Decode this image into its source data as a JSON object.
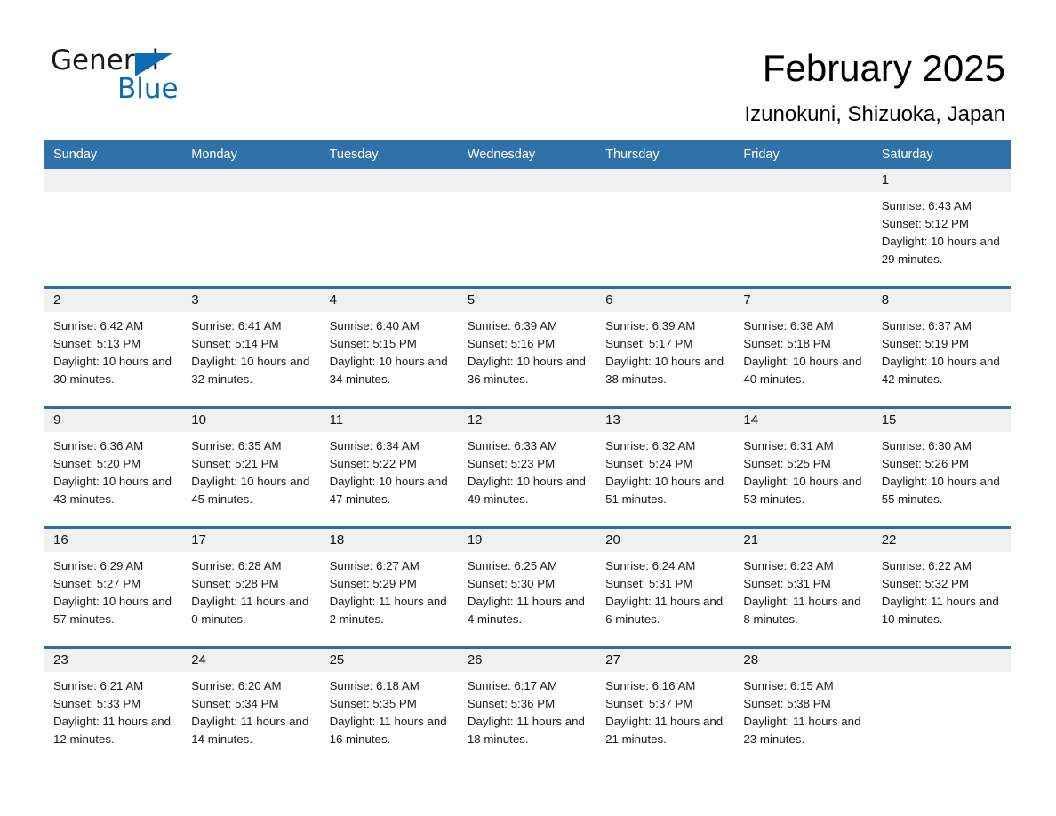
{
  "brand": {
    "name_top": "General",
    "name_bottom": "Blue",
    "triangle_icon": "blue-triangle-icon",
    "accent_color": "#0a6cb4"
  },
  "header": {
    "title": "February 2025",
    "subtitle": "Izunokuni, Shizuoka, Japan"
  },
  "theme": {
    "header_blue": "#3071a9",
    "row_border_blue": "#2e6da4",
    "daynum_strip": "#f0f0f0"
  },
  "calendar": {
    "weekday_headers": [
      "Sunday",
      "Monday",
      "Tuesday",
      "Wednesday",
      "Thursday",
      "Friday",
      "Saturday"
    ],
    "weeks": [
      [
        {
          "day": "",
          "sunrise": "",
          "sunset": "",
          "daylight": ""
        },
        {
          "day": "",
          "sunrise": "",
          "sunset": "",
          "daylight": ""
        },
        {
          "day": "",
          "sunrise": "",
          "sunset": "",
          "daylight": ""
        },
        {
          "day": "",
          "sunrise": "",
          "sunset": "",
          "daylight": ""
        },
        {
          "day": "",
          "sunrise": "",
          "sunset": "",
          "daylight": ""
        },
        {
          "day": "",
          "sunrise": "",
          "sunset": "",
          "daylight": ""
        },
        {
          "day": "1",
          "sunrise": "Sunrise: 6:43 AM",
          "sunset": "Sunset: 5:12 PM",
          "daylight": "Daylight: 10 hours and 29 minutes."
        }
      ],
      [
        {
          "day": "2",
          "sunrise": "Sunrise: 6:42 AM",
          "sunset": "Sunset: 5:13 PM",
          "daylight": "Daylight: 10 hours and 30 minutes."
        },
        {
          "day": "3",
          "sunrise": "Sunrise: 6:41 AM",
          "sunset": "Sunset: 5:14 PM",
          "daylight": "Daylight: 10 hours and 32 minutes."
        },
        {
          "day": "4",
          "sunrise": "Sunrise: 6:40 AM",
          "sunset": "Sunset: 5:15 PM",
          "daylight": "Daylight: 10 hours and 34 minutes."
        },
        {
          "day": "5",
          "sunrise": "Sunrise: 6:39 AM",
          "sunset": "Sunset: 5:16 PM",
          "daylight": "Daylight: 10 hours and 36 minutes."
        },
        {
          "day": "6",
          "sunrise": "Sunrise: 6:39 AM",
          "sunset": "Sunset: 5:17 PM",
          "daylight": "Daylight: 10 hours and 38 minutes."
        },
        {
          "day": "7",
          "sunrise": "Sunrise: 6:38 AM",
          "sunset": "Sunset: 5:18 PM",
          "daylight": "Daylight: 10 hours and 40 minutes."
        },
        {
          "day": "8",
          "sunrise": "Sunrise: 6:37 AM",
          "sunset": "Sunset: 5:19 PM",
          "daylight": "Daylight: 10 hours and 42 minutes."
        }
      ],
      [
        {
          "day": "9",
          "sunrise": "Sunrise: 6:36 AM",
          "sunset": "Sunset: 5:20 PM",
          "daylight": "Daylight: 10 hours and 43 minutes."
        },
        {
          "day": "10",
          "sunrise": "Sunrise: 6:35 AM",
          "sunset": "Sunset: 5:21 PM",
          "daylight": "Daylight: 10 hours and 45 minutes."
        },
        {
          "day": "11",
          "sunrise": "Sunrise: 6:34 AM",
          "sunset": "Sunset: 5:22 PM",
          "daylight": "Daylight: 10 hours and 47 minutes."
        },
        {
          "day": "12",
          "sunrise": "Sunrise: 6:33 AM",
          "sunset": "Sunset: 5:23 PM",
          "daylight": "Daylight: 10 hours and 49 minutes."
        },
        {
          "day": "13",
          "sunrise": "Sunrise: 6:32 AM",
          "sunset": "Sunset: 5:24 PM",
          "daylight": "Daylight: 10 hours and 51 minutes."
        },
        {
          "day": "14",
          "sunrise": "Sunrise: 6:31 AM",
          "sunset": "Sunset: 5:25 PM",
          "daylight": "Daylight: 10 hours and 53 minutes."
        },
        {
          "day": "15",
          "sunrise": "Sunrise: 6:30 AM",
          "sunset": "Sunset: 5:26 PM",
          "daylight": "Daylight: 10 hours and 55 minutes."
        }
      ],
      [
        {
          "day": "16",
          "sunrise": "Sunrise: 6:29 AM",
          "sunset": "Sunset: 5:27 PM",
          "daylight": "Daylight: 10 hours and 57 minutes."
        },
        {
          "day": "17",
          "sunrise": "Sunrise: 6:28 AM",
          "sunset": "Sunset: 5:28 PM",
          "daylight": "Daylight: 11 hours and 0 minutes."
        },
        {
          "day": "18",
          "sunrise": "Sunrise: 6:27 AM",
          "sunset": "Sunset: 5:29 PM",
          "daylight": "Daylight: 11 hours and 2 minutes."
        },
        {
          "day": "19",
          "sunrise": "Sunrise: 6:25 AM",
          "sunset": "Sunset: 5:30 PM",
          "daylight": "Daylight: 11 hours and 4 minutes."
        },
        {
          "day": "20",
          "sunrise": "Sunrise: 6:24 AM",
          "sunset": "Sunset: 5:31 PM",
          "daylight": "Daylight: 11 hours and 6 minutes."
        },
        {
          "day": "21",
          "sunrise": "Sunrise: 6:23 AM",
          "sunset": "Sunset: 5:31 PM",
          "daylight": "Daylight: 11 hours and 8 minutes."
        },
        {
          "day": "22",
          "sunrise": "Sunrise: 6:22 AM",
          "sunset": "Sunset: 5:32 PM",
          "daylight": "Daylight: 11 hours and 10 minutes."
        }
      ],
      [
        {
          "day": "23",
          "sunrise": "Sunrise: 6:21 AM",
          "sunset": "Sunset: 5:33 PM",
          "daylight": "Daylight: 11 hours and 12 minutes."
        },
        {
          "day": "24",
          "sunrise": "Sunrise: 6:20 AM",
          "sunset": "Sunset: 5:34 PM",
          "daylight": "Daylight: 11 hours and 14 minutes."
        },
        {
          "day": "25",
          "sunrise": "Sunrise: 6:18 AM",
          "sunset": "Sunset: 5:35 PM",
          "daylight": "Daylight: 11 hours and 16 minutes."
        },
        {
          "day": "26",
          "sunrise": "Sunrise: 6:17 AM",
          "sunset": "Sunset: 5:36 PM",
          "daylight": "Daylight: 11 hours and 18 minutes."
        },
        {
          "day": "27",
          "sunrise": "Sunrise: 6:16 AM",
          "sunset": "Sunset: 5:37 PM",
          "daylight": "Daylight: 11 hours and 21 minutes."
        },
        {
          "day": "28",
          "sunrise": "Sunrise: 6:15 AM",
          "sunset": "Sunset: 5:38 PM",
          "daylight": "Daylight: 11 hours and 23 minutes."
        },
        {
          "day": "",
          "sunrise": "",
          "sunset": "",
          "daylight": ""
        }
      ]
    ]
  }
}
